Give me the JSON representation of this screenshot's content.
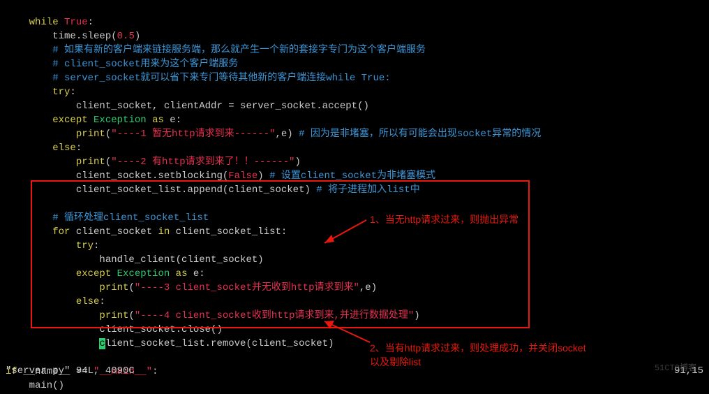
{
  "code": {
    "l1_kw": "while",
    "l1_bool": "True",
    "l1_rest": ":",
    "l2a": "        time.sleep(",
    "l2_num": "0.5",
    "l2b": ")",
    "l3": "        # 如果有新的客户端来链接服务端，那么就产生一个新的套接字专门为这个客户端服务",
    "l4": "        # client_socket用来为这个客户端服务",
    "l5": "        # server_socket就可以省下来专门等待其他新的客户端连接while True:",
    "l6": "        try",
    "l7": "            client_socket, clientAddr = server_socket.accept()",
    "l8a": "        except",
    "l8b": "Exception",
    "l8c": "as",
    "l8d": "e:",
    "l9a": "            print",
    "l9b": "(",
    "l9_str": "\"----1 暂无http请求到来------\"",
    "l9c": ",e) ",
    "l9_cm": "# 因为是非堵塞，所以有可能会出现socket异常的情况",
    "l10": "        else",
    "l11a": "            print",
    "l11b": "(",
    "l11_str": "\"----2 有http请求到来了！！------\"",
    "l11c": ")",
    "l12a": "            client_socket.setblocking(",
    "l12_bool": "False",
    "l12b": ") ",
    "l12_cm": "# 设置client_socket为非堵塞模式",
    "l13a": "            client_socket_list.append(client_socket) ",
    "l13_cm": "# 将子进程加入list中",
    "l15": "        # 循环处理client_socket_list",
    "l16a": "        for",
    "l16b": "client_socket",
    "l16c": "in",
    "l16d": "client_socket_list:",
    "l17": "            try",
    "l18": "                handle_client(client_socket)",
    "l19a": "            except",
    "l19b": "Exception",
    "l19c": "as",
    "l19d": "e:",
    "l20a": "                print",
    "l20b": "(",
    "l20_str": "\"----3 client_socket并无收到http请求到来\"",
    "l20c": ",e)",
    "l21": "            else",
    "l22a": "                print",
    "l22b": "(",
    "l22_str": "\"----4 client_socket收到http请求到来,并进行数据处理\"",
    "l22c": ")",
    "l23": "                client_socket.close()",
    "l24a": "                ",
    "l24_cur": "c",
    "l24b": "lient_socket_list.remove(client_socket)",
    "l26a": "if",
    "l26b": "__name__ ==",
    "l26_str": "\"__main__\"",
    "l26c": ":",
    "l27": "    main()"
  },
  "annotations": {
    "a1": "1、当无http请求过来，则抛出异常",
    "a2": "2、当有http请求过来，则处理成功，并关闭socket\n以及剔除list"
  },
  "status": {
    "left": "\"server.py\" 94L, 4090C",
    "right": "91,15"
  },
  "watermark": "51CTO博客"
}
